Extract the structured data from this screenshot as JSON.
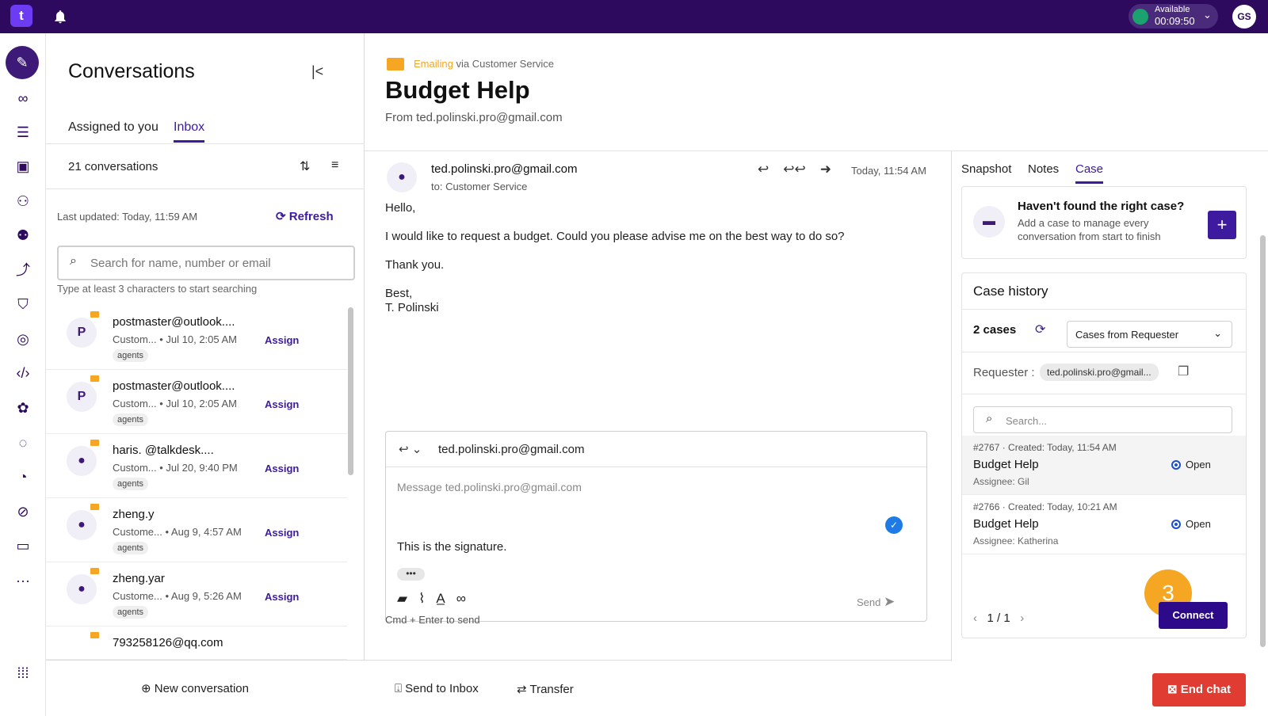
{
  "topbar": {
    "logo": "t",
    "status": "Available",
    "timer": "00:09:50",
    "user_initials": "GS"
  },
  "conversations": {
    "title": "Conversations",
    "tabs": [
      "Assigned to you",
      "Inbox"
    ],
    "active_tab": "Inbox",
    "count_label": "21 conversations",
    "last_updated": "Last updated: Today, 11:59 AM",
    "refresh_label": "Refresh",
    "search_placeholder": "Search for name, number or email",
    "search_hint": "Type at least 3 characters to start searching",
    "items": [
      {
        "avatar": "P",
        "name": "postmaster@outlook....",
        "sub": "Custom...  • Jul 10, 2:05 AM",
        "tag": "agents",
        "action": "Assign"
      },
      {
        "avatar": "P",
        "name": "postmaster@outlook....",
        "sub": "Custom...  • Jul 10, 2:05 AM",
        "tag": "agents",
        "action": "Assign"
      },
      {
        "avatar": "",
        "name": "haris.        @talkdesk....",
        "sub": "Custom...  • Jul 20, 9:40 PM",
        "tag": "agents",
        "action": "Assign"
      },
      {
        "avatar": "",
        "name": "zheng.y",
        "sub": "Custome...  • Aug 9, 4:57 AM",
        "tag": "agents",
        "action": "Assign"
      },
      {
        "avatar": "",
        "name": "zheng.yar",
        "sub": "Custome...  • Aug 9, 5:26 AM",
        "tag": "agents",
        "action": "Assign"
      },
      {
        "avatar": "",
        "name": "793258126@qq.com",
        "sub": "",
        "tag": "",
        "action": ""
      }
    ],
    "new_conversation": "New conversation"
  },
  "email": {
    "channel": "Emailing",
    "via": "via Customer Service",
    "title": "Budget Help",
    "from": "From ted.polinski.pro@gmail.com",
    "message": {
      "from": "ted.polinski.pro@gmail.com",
      "to": "to: Customer Service",
      "time": "Today, 11:54 AM",
      "lines": [
        "Hello,",
        "I would like to request a budget. Could you please advise me on the best way to do so?",
        "Thank you.",
        "Best,",
        "T. Polinski"
      ]
    },
    "compose": {
      "to": "ted.polinski.pro@gmail.com",
      "placeholder": "Message ted.polinski.pro@gmail.com",
      "signature": "This is the signature.",
      "more": "•••",
      "send": "Send",
      "hint": "Cmd + Enter to send"
    },
    "bottom": {
      "send_to_inbox": "Send to Inbox",
      "transfer": "Transfer",
      "end_chat": "End chat"
    }
  },
  "sidepanel": {
    "tabs": [
      "Snapshot",
      "Notes",
      "Case"
    ],
    "active_tab": "Case",
    "promo_title": "Haven't found the right case?",
    "promo_text1": "Add a case to manage every",
    "promo_text2": "conversation from start to finish",
    "history_title": "Case history",
    "cases_count": "2 cases",
    "filter_value": "Cases from Requester",
    "requester_label": "Requester :",
    "requester_value": "ted.polinski.pro@gmail...",
    "search_placeholder": "Search...",
    "cases": [
      {
        "meta": "#2767 · Created: Today, 11:54 AM",
        "title": "Budget Help",
        "assignee": "Assignee: Gil",
        "status": "Open"
      },
      {
        "meta": "#2766 · Created: Today, 10:21 AM",
        "title": "Budget Help",
        "assignee": "Assignee: Katherina",
        "status": "Open"
      }
    ],
    "pager": "1 / 1",
    "step_badge": "3",
    "connect": "Connect"
  }
}
